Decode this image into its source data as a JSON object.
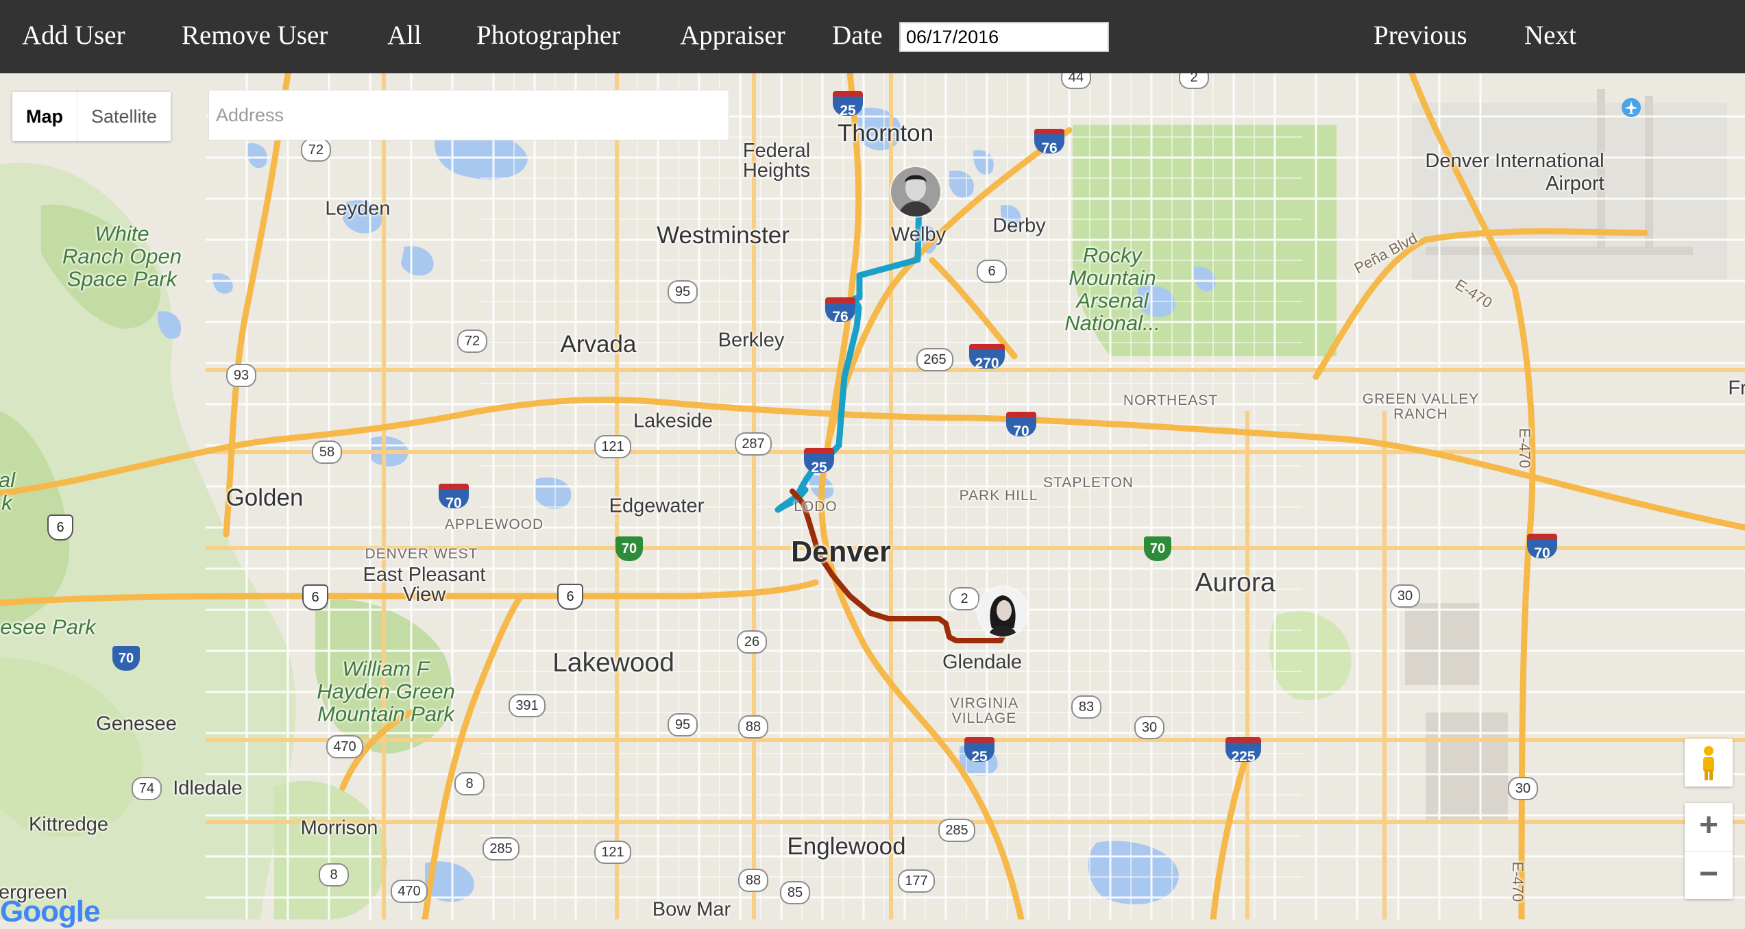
{
  "navbar": {
    "add_user": "Add User",
    "remove_user": "Remove User",
    "all": "All",
    "photographer": "Photographer",
    "appraiser": "Appraiser",
    "date_label": "Date",
    "date_value": "06/17/2016",
    "previous": "Previous",
    "next": "Next"
  },
  "map_controls": {
    "map_label": "Map",
    "satellite_label": "Satellite",
    "active_type": "Map",
    "address_placeholder": "Address",
    "zoom_in": "+",
    "zoom_out": "−",
    "logo": "Google"
  },
  "places": {
    "thornton": "Thornton",
    "federal_heights": "Federal\nHeights",
    "westminster": "Westminster",
    "welby": "Welby",
    "derby": "Derby",
    "leyden": "Leyden",
    "arvada": "Arvada",
    "berkley": "Berkley",
    "lakeside": "Lakeside",
    "golden": "Golden",
    "edgewater": "Edgewater",
    "applewood": "APPLEWOOD",
    "denver_west": "DENVER WEST",
    "east_pleasant_view": "East Pleasant\nView",
    "lodo": "LODO",
    "denver": "Denver",
    "park_hill": "PARK HILL",
    "stapleton": "STAPLETON",
    "northeast": "NORTHEAST",
    "green_valley_ranch": "GREEN VALLEY\nRANCH",
    "aurora": "Aurora",
    "glendale": "Glendale",
    "virginia_village": "VIRGINIA\nVILLAGE",
    "lakewood": "Lakewood",
    "genesee": "Genesee",
    "idledale": "Idledale",
    "kittredge": "Kittredge",
    "morrison": "Morrison",
    "englewood": "Englewood",
    "bow_mar": "Bow Mar",
    "evergreen": "ergreen",
    "denver_international_airport": "Denver International\nAirport",
    "white_ranch": "White\nRanch Open\nSpace Park",
    "rocky_mountain_arsenal": "Rocky\nMountain\nArsenal\nNational...",
    "william_f_hayden": "William F\nHayden Green\nMountain Park",
    "genesee_park": "esee Park",
    "golden_edge": "al\nk",
    "pena_blvd": "Peña Blvd",
    "e470_top": "E-470",
    "e470_mid": "E-470",
    "e470_low": "E-470",
    "fr_edge": "Fr"
  },
  "shields": {
    "i25_north": "25",
    "i76_east": "76",
    "i76": "76",
    "i270": "270",
    "i70_west": "70",
    "i70_mid": "70",
    "i70_east": "70",
    "i25_south": "25",
    "i225": "225",
    "i25_denver": "25",
    "r44": "44",
    "r2_top": "2",
    "r72_top": "72",
    "r95_top": "95",
    "r72_mid": "72",
    "r93": "93",
    "r6_mid": "6",
    "r265": "265",
    "r121_top": "121",
    "r287": "287",
    "r58": "58",
    "r2_denver": "2",
    "r30_east": "30",
    "r26": "26",
    "r391": "391",
    "r95_low": "95",
    "r88_mid": "88",
    "r83": "83",
    "r30_mid": "30",
    "r470_mid": "470",
    "r74": "74",
    "r8_top": "8",
    "r285_low": "285",
    "r121_low": "121",
    "r285_mid": "285",
    "r8_low": "8",
    "r470_low": "470",
    "r88_low": "88",
    "r85": "85",
    "r177": "177",
    "r30_low": "30",
    "u6_top": "6",
    "u6_mid": "6",
    "u6_east": "6",
    "g70_west": "70",
    "g70_east": "70"
  },
  "colors": {
    "navbar": "#333333",
    "photographer_route": "#1a9fc9",
    "appraiser_route": "#9b2d08",
    "interstate": "#2f63b0",
    "highway": "#f6c36b",
    "park": "#cde7b0",
    "water": "#a8c8f0"
  },
  "icons": {
    "photographer_avatar": "male-portrait-icon",
    "appraiser_avatar": "female-portrait-icon",
    "airport": "airplane-icon",
    "pegman": "street-view-pegman-icon"
  }
}
